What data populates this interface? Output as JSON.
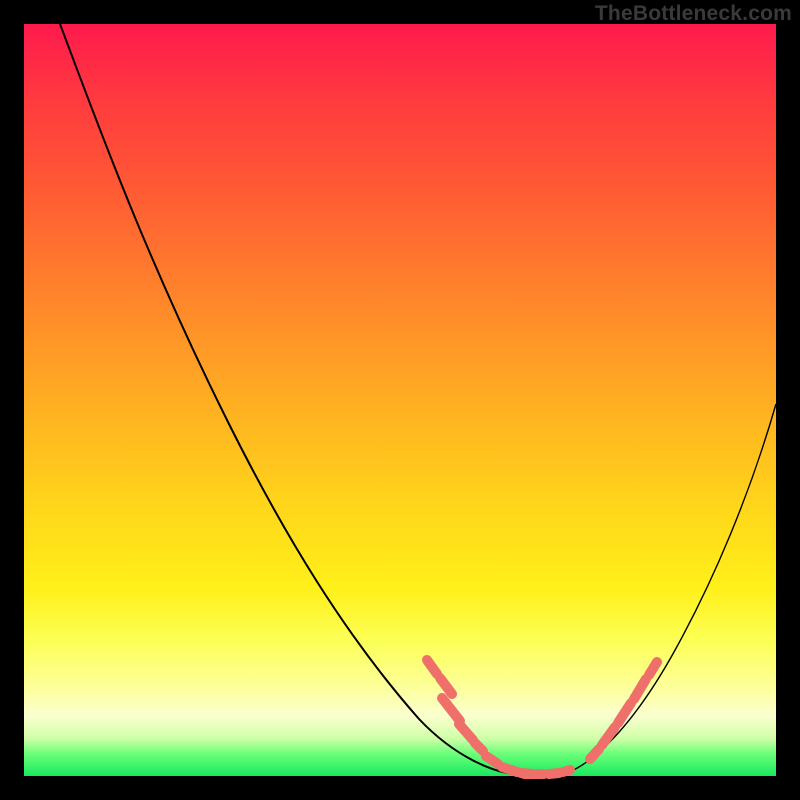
{
  "watermark": "TheBottleneck.com",
  "chart_data": {
    "type": "line",
    "title": "",
    "xlabel": "",
    "ylabel": "",
    "xlim": [
      0,
      100
    ],
    "ylim": [
      0,
      100
    ],
    "series": [
      {
        "name": "bottleneck-curve",
        "x": [
          5,
          10,
          15,
          20,
          25,
          30,
          35,
          40,
          45,
          50,
          55,
          58,
          60,
          62,
          64,
          66,
          68,
          70,
          73,
          76,
          80,
          85,
          90,
          95,
          100
        ],
        "y": [
          100,
          92,
          84,
          76,
          68,
          59,
          50,
          41,
          32,
          23,
          14,
          9,
          6,
          3,
          1,
          0,
          0,
          1,
          4,
          9,
          16,
          25,
          34,
          42,
          50
        ]
      }
    ],
    "highlighted_segments": [
      {
        "side": "left",
        "x": [
          55,
          60.5
        ],
        "y": [
          14,
          5
        ]
      },
      {
        "side": "floor",
        "x": [
          60,
          71
        ],
        "y": [
          4,
          2
        ]
      },
      {
        "side": "right",
        "x": [
          72,
          79
        ],
        "y": [
          4,
          15
        ]
      }
    ],
    "colors": {
      "curve": "#000000",
      "highlight": "#ef6f6a",
      "gradient_top": "#ff1a4d",
      "gradient_bottom": "#19e85f"
    }
  }
}
